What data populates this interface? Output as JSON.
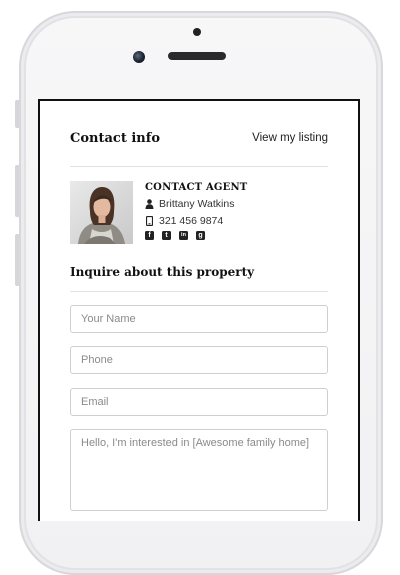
{
  "header": {
    "title": "Contact info",
    "listing_link": "View my listing"
  },
  "agent": {
    "section_title": "CONTACT AGENT",
    "name": "Brittany Watkins",
    "phone": "321 456 9874",
    "icons": {
      "person": "person-icon",
      "phone": "phone-icon"
    },
    "socials": [
      {
        "name": "facebook-icon",
        "glyph": "f"
      },
      {
        "name": "twitter-icon",
        "glyph": "t"
      },
      {
        "name": "linkedin-icon",
        "glyph": "in"
      },
      {
        "name": "googleplus-icon",
        "glyph": "g"
      }
    ]
  },
  "inquiry": {
    "title": "Inquire about this property",
    "name_placeholder": "Your Name",
    "phone_placeholder": "Phone",
    "email_placeholder": "Email",
    "message_placeholder": "Hello, I'm interested in [Awesome family home]"
  },
  "colors": {
    "text": "#111111",
    "border": "#cfcfcf",
    "divider": "#e2e2e2"
  }
}
